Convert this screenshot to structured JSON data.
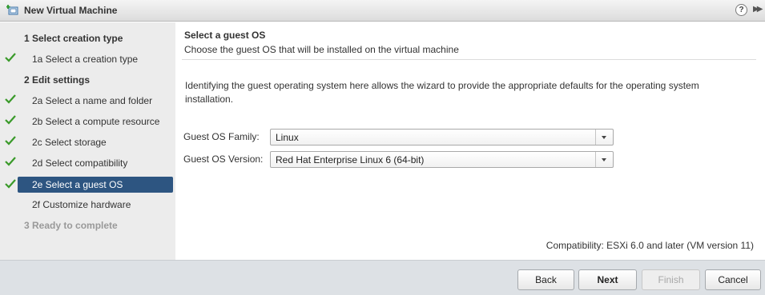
{
  "window": {
    "title": "New Virtual Machine",
    "help": "?",
    "expand": "▶▶"
  },
  "steps": [
    {
      "label": "1  Select creation type",
      "checked": false
    },
    {
      "label": "1a  Select a creation type",
      "checked": true
    },
    {
      "label": "2  Edit settings",
      "checked": false
    },
    {
      "label": "2a  Select a name and folder",
      "checked": true
    },
    {
      "label": "2b  Select a compute resource",
      "checked": true
    },
    {
      "label": "2c  Select storage",
      "checked": true
    },
    {
      "label": "2d  Select compatibility",
      "checked": true
    },
    {
      "label": "2e  Select a guest OS",
      "checked": true,
      "selected": true
    },
    {
      "label": "2f  Customize hardware",
      "checked": false
    },
    {
      "label": "3  Ready to complete",
      "checked": false,
      "disabled": true
    }
  ],
  "main": {
    "title": "Select a guest OS",
    "subtitle": "Choose the guest OS that will be installed on the virtual machine",
    "intro": "Identifying the guest operating system here allows the wizard to provide the appropriate defaults for the operating system installation.",
    "family_label": "Guest OS Family:",
    "family_value": "Linux",
    "version_label": "Guest OS Version:",
    "version_value": "Red Hat Enterprise Linux 6 (64-bit)",
    "compatibility": "Compatibility: ESXi 6.0 and later (VM version 11)"
  },
  "footer": {
    "back": "Back",
    "next": "Next",
    "finish": "Finish",
    "cancel": "Cancel"
  },
  "colors": {
    "selected": "#2d5581",
    "check": "#3a9a2a"
  }
}
